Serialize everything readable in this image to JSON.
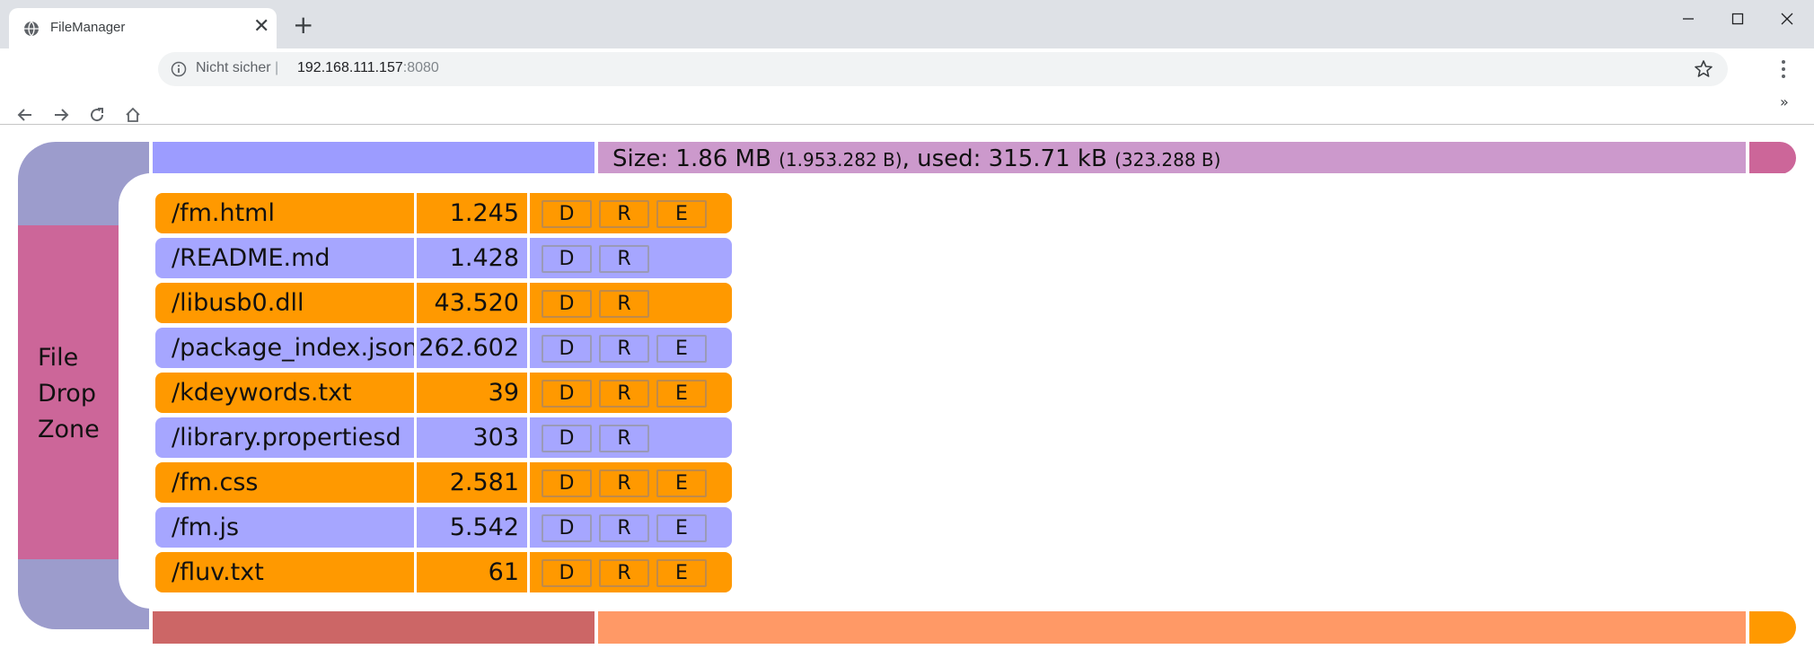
{
  "browser": {
    "tab_title": "FileManager",
    "tab_close_glyph": "✕",
    "new_tab_glyph": "+",
    "window_controls": {
      "minimize": "—",
      "maximize": "☐",
      "close": "✕"
    },
    "security_label": "Nicht sicher",
    "separator": "|",
    "url_host": "192.168.111.157",
    "url_port": ":8080",
    "bookmarks_more": "»",
    "icons": [
      "globe-icon",
      "back-icon",
      "forward-icon",
      "reload-icon",
      "home-icon",
      "info-icon",
      "star-icon",
      "menu-icon"
    ]
  },
  "status": {
    "size_label": "Size: 1.86 MB",
    "size_bytes": "(1.953.282 B)",
    "used_label": ", used: 315.71 kB",
    "used_bytes": "(323.288 B)"
  },
  "dropzone": {
    "line1": "File",
    "line2": "Drop",
    "line3": "Zone"
  },
  "files": [
    {
      "name": "/fm.html",
      "size": "1.245",
      "color": "orange",
      "actions": [
        "D",
        "R",
        "E"
      ]
    },
    {
      "name": "/README.md",
      "size": "1.428",
      "color": "blue",
      "actions": [
        "D",
        "R"
      ]
    },
    {
      "name": "/libusb0.dll",
      "size": "43.520",
      "color": "orange",
      "actions": [
        "D",
        "R"
      ]
    },
    {
      "name": "/package_index.json",
      "size": "262.602",
      "color": "blue",
      "actions": [
        "D",
        "R",
        "E"
      ]
    },
    {
      "name": "/kdeywords.txt",
      "size": "39",
      "color": "orange",
      "actions": [
        "D",
        "R",
        "E"
      ]
    },
    {
      "name": "/library.propertiesd",
      "size": "303",
      "color": "blue",
      "actions": [
        "D",
        "R"
      ]
    },
    {
      "name": "/fm.css",
      "size": "2.581",
      "color": "orange",
      "actions": [
        "D",
        "R",
        "E"
      ]
    },
    {
      "name": "/fm.js",
      "size": "5.542",
      "color": "blue",
      "actions": [
        "D",
        "R",
        "E"
      ]
    },
    {
      "name": "/fluv.txt",
      "size": "61",
      "color": "orange",
      "actions": [
        "D",
        "R",
        "E"
      ]
    }
  ],
  "colors": {
    "frame_purple": "#9c9ccc",
    "dropzone_pink": "#cc6699",
    "row_orange": "#ff9900",
    "row_blue": "#a6a6ff",
    "top_blue": "#9c9cff",
    "top_mauve": "#cc99cc",
    "bottom_red": "#cc6666",
    "bottom_salmon": "#ff9966"
  }
}
